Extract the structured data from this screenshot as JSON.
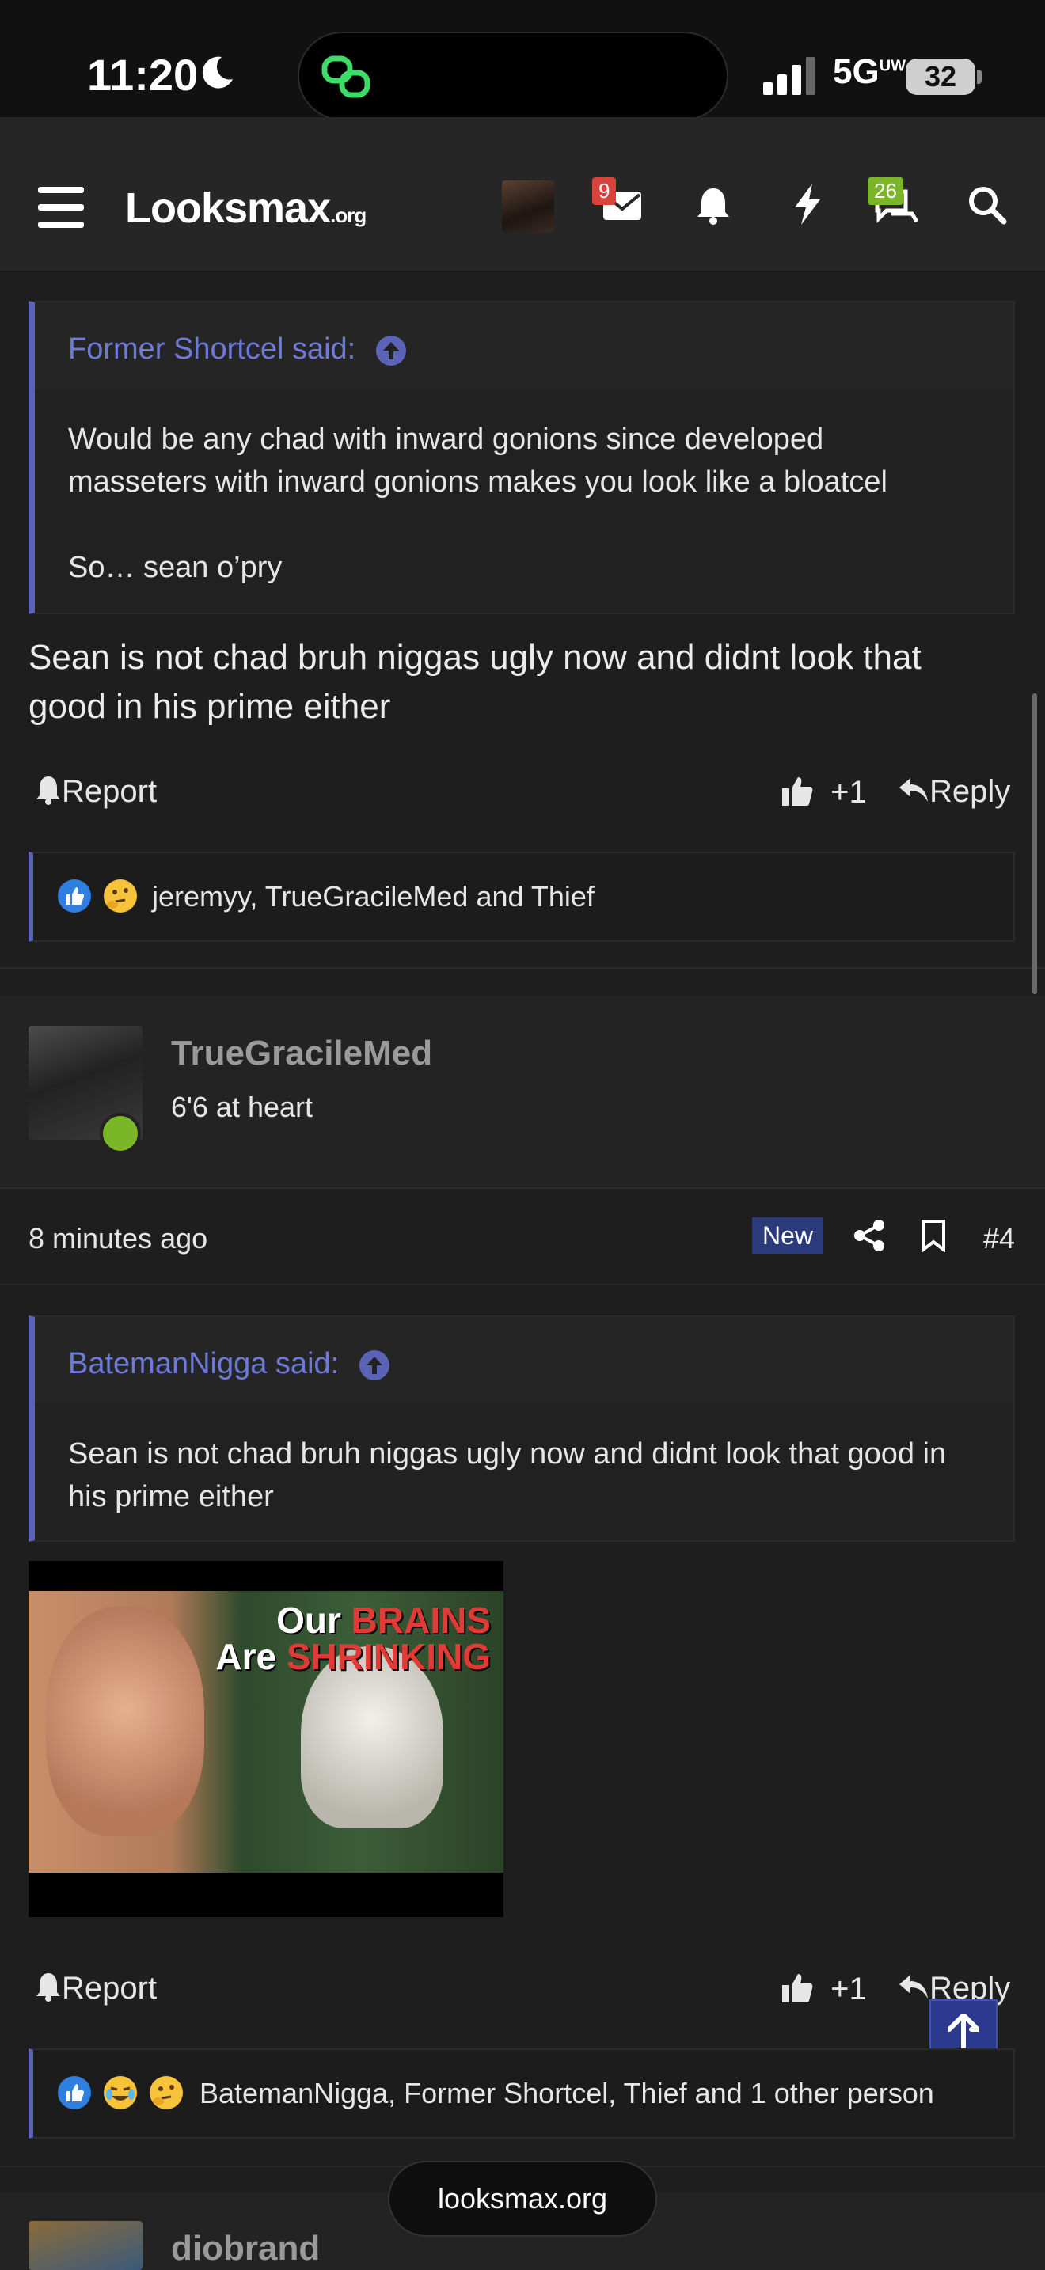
{
  "status_bar": {
    "time": "11:20",
    "network": "5G",
    "network_sup": "UW",
    "battery": "32"
  },
  "nav": {
    "logo": "Looksmax",
    "logo_suffix": ".org",
    "inbox_badge": "9",
    "chat_badge": "26"
  },
  "post3": {
    "quote_author": "Former Shortcel said:",
    "quote_lines": [
      "Would be any chad with inward gonions since developed",
      "masseters with inward gonions makes you look like a bloatcel"
    ],
    "quote_extra": "So… sean o’pry",
    "message_lines": [
      "Sean is not chad bruh niggas ugly now and didnt look that",
      "good in his prime either"
    ],
    "report": "Report",
    "likes": "+1",
    "reply": "Reply",
    "reactions": "jeremyy, TrueGracileMed and Thief"
  },
  "post4": {
    "username": "TrueGracileMed",
    "user_title": "6'6 at heart",
    "time": "8 minutes ago",
    "new_label": "New",
    "post_number": "#4",
    "quote_author": "BatemanNigga said:",
    "quote_lines": [
      "Sean is not chad bruh niggas ugly now and didnt look that good in",
      "his prime either"
    ],
    "thumbnail_line1a": "Our ",
    "thumbnail_line1b": "BRAINS",
    "thumbnail_line2a": "Are ",
    "thumbnail_line2b": "SHRINKING",
    "report": "Report",
    "likes": "+1",
    "reply": "Reply",
    "reactions": "BatemanNigga, Former Shortcel, Thief and 1 other person"
  },
  "post5": {
    "username": "diobrand"
  },
  "footer": {
    "url": "looksmax.org"
  },
  "colors": {
    "accent": "#5b63b7",
    "link": "#6d7ad8",
    "online": "#7bb528",
    "badge_red": "#d9433c",
    "badge_green": "#7bb528"
  }
}
